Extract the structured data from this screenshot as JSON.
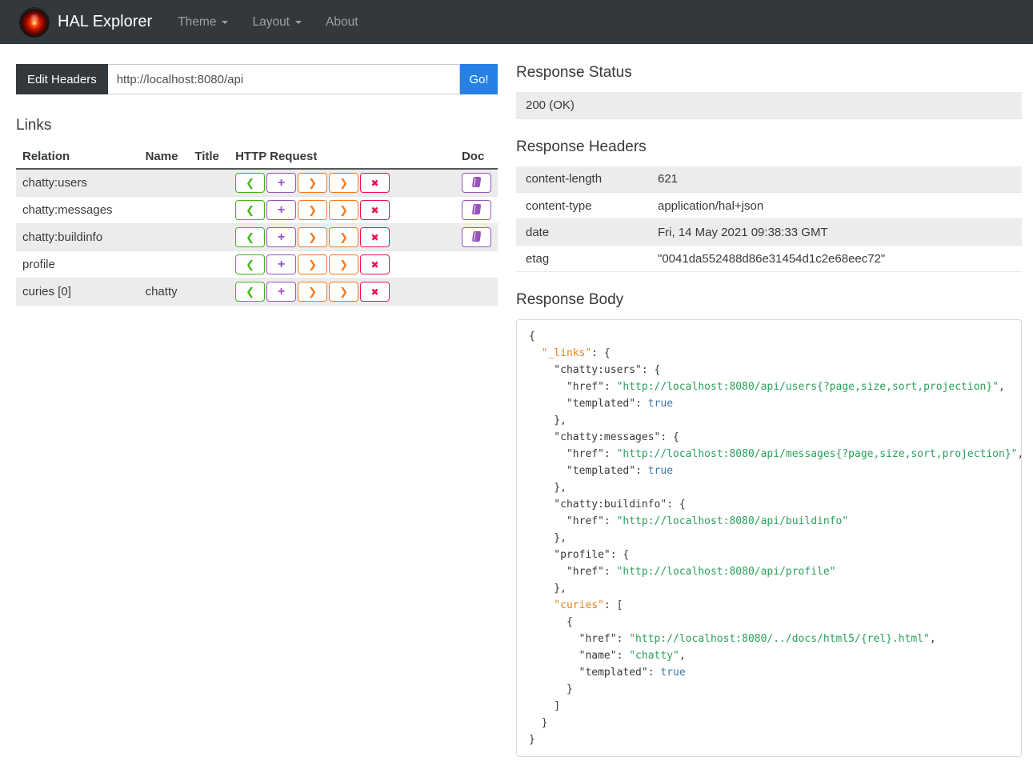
{
  "navbar": {
    "brand": "HAL Explorer",
    "items": [
      {
        "id": "theme",
        "label": "Theme",
        "has_caret": true
      },
      {
        "id": "layout",
        "label": "Layout",
        "has_caret": true
      },
      {
        "id": "about",
        "label": "About",
        "has_caret": false
      }
    ]
  },
  "request_bar": {
    "edit_headers_label": "Edit Headers",
    "url_value": "http://localhost:8080/api",
    "go_label": "Go!"
  },
  "links_section": {
    "title": "Links",
    "columns": [
      "Relation",
      "Name",
      "Title",
      "HTTP Request",
      "Doc"
    ],
    "http_buttons": [
      {
        "name": "get-button",
        "icon": "chevron-left-icon",
        "glyph": "❮",
        "color": "#3fb618"
      },
      {
        "name": "post-button",
        "icon": "plus-icon",
        "glyph": "+",
        "color": "#9954bb"
      },
      {
        "name": "put-button",
        "icon": "chevron-right-icon",
        "glyph": "❯",
        "color": "#f5791d"
      },
      {
        "name": "patch-button",
        "icon": "chevron-right-icon",
        "glyph": "❯",
        "color": "#f5791d"
      },
      {
        "name": "delete-button",
        "icon": "x-icon",
        "glyph": "✖",
        "color": "#ef1250"
      }
    ],
    "doc_color": "#9954bb",
    "rows": [
      {
        "relation": "chatty:users",
        "name": "",
        "title": "",
        "doc": true
      },
      {
        "relation": "chatty:messages",
        "name": "",
        "title": "",
        "doc": true
      },
      {
        "relation": "chatty:buildinfo",
        "name": "",
        "title": "",
        "doc": true
      },
      {
        "relation": "profile",
        "name": "",
        "title": "",
        "doc": false
      },
      {
        "relation": "curies [0]",
        "name": "chatty",
        "title": "",
        "doc": false
      }
    ]
  },
  "response_status": {
    "title": "Response Status",
    "value": "200 (OK)"
  },
  "response_headers": {
    "title": "Response Headers",
    "rows": [
      {
        "key": "content-length",
        "value": "621"
      },
      {
        "key": "content-type",
        "value": "application/hal+json"
      },
      {
        "key": "date",
        "value": "Fri, 14 May 2021 09:38:33 GMT"
      },
      {
        "key": "etag",
        "value": "\"0041da552488d86e31454d1c2e68eec72\""
      }
    ]
  },
  "response_body": {
    "title": "Response Body",
    "lines": [
      [
        {
          "t": "plain",
          "s": "{"
        }
      ],
      [
        {
          "t": "special",
          "s": "  \"_links\""
        },
        {
          "t": "plain",
          "s": ": {"
        }
      ],
      [
        {
          "t": "key",
          "s": "    \"chatty:users\""
        },
        {
          "t": "plain",
          "s": ": {"
        }
      ],
      [
        {
          "t": "key",
          "s": "      \"href\""
        },
        {
          "t": "plain",
          "s": ": "
        },
        {
          "t": "str",
          "s": "\"http://localhost:8080/api/users{?page,size,sort,projection}\""
        },
        {
          "t": "plain",
          "s": ","
        }
      ],
      [
        {
          "t": "key",
          "s": "      \"templated\""
        },
        {
          "t": "plain",
          "s": ": "
        },
        {
          "t": "bool",
          "s": "true"
        }
      ],
      [
        {
          "t": "plain",
          "s": "    },"
        }
      ],
      [
        {
          "t": "key",
          "s": "    \"chatty:messages\""
        },
        {
          "t": "plain",
          "s": ": {"
        }
      ],
      [
        {
          "t": "key",
          "s": "      \"href\""
        },
        {
          "t": "plain",
          "s": ": "
        },
        {
          "t": "str",
          "s": "\"http://localhost:8080/api/messages{?page,size,sort,projection}\""
        },
        {
          "t": "plain",
          "s": ","
        }
      ],
      [
        {
          "t": "key",
          "s": "      \"templated\""
        },
        {
          "t": "plain",
          "s": ": "
        },
        {
          "t": "bool",
          "s": "true"
        }
      ],
      [
        {
          "t": "plain",
          "s": "    },"
        }
      ],
      [
        {
          "t": "key",
          "s": "    \"chatty:buildinfo\""
        },
        {
          "t": "plain",
          "s": ": {"
        }
      ],
      [
        {
          "t": "key",
          "s": "      \"href\""
        },
        {
          "t": "plain",
          "s": ": "
        },
        {
          "t": "str",
          "s": "\"http://localhost:8080/api/buildinfo\""
        }
      ],
      [
        {
          "t": "plain",
          "s": "    },"
        }
      ],
      [
        {
          "t": "key",
          "s": "    \"profile\""
        },
        {
          "t": "plain",
          "s": ": {"
        }
      ],
      [
        {
          "t": "key",
          "s": "      \"href\""
        },
        {
          "t": "plain",
          "s": ": "
        },
        {
          "t": "str",
          "s": "\"http://localhost:8080/api/profile\""
        }
      ],
      [
        {
          "t": "plain",
          "s": "    },"
        }
      ],
      [
        {
          "t": "special",
          "s": "    \"curies\""
        },
        {
          "t": "plain",
          "s": ": ["
        }
      ],
      [
        {
          "t": "plain",
          "s": "      {"
        }
      ],
      [
        {
          "t": "key",
          "s": "        \"href\""
        },
        {
          "t": "plain",
          "s": ": "
        },
        {
          "t": "str",
          "s": "\"http://localhost:8080/../docs/html5/{rel}.html\""
        },
        {
          "t": "plain",
          "s": ","
        }
      ],
      [
        {
          "t": "key",
          "s": "        \"name\""
        },
        {
          "t": "plain",
          "s": ": "
        },
        {
          "t": "str",
          "s": "\"chatty\""
        },
        {
          "t": "plain",
          "s": ","
        }
      ],
      [
        {
          "t": "key",
          "s": "        \"templated\""
        },
        {
          "t": "plain",
          "s": ": "
        },
        {
          "t": "bool",
          "s": "true"
        }
      ],
      [
        {
          "t": "plain",
          "s": "      }"
        }
      ],
      [
        {
          "t": "plain",
          "s": "    ]"
        }
      ],
      [
        {
          "t": "plain",
          "s": "  }"
        }
      ],
      [
        {
          "t": "plain",
          "s": "}"
        }
      ]
    ]
  },
  "colors": {
    "primary": "#2780e3",
    "navbar_bg": "#33383c",
    "stripe": "#ececec",
    "json_special": "#e8821e",
    "json_string": "#2aa05a",
    "json_bool": "#3a77b0"
  }
}
